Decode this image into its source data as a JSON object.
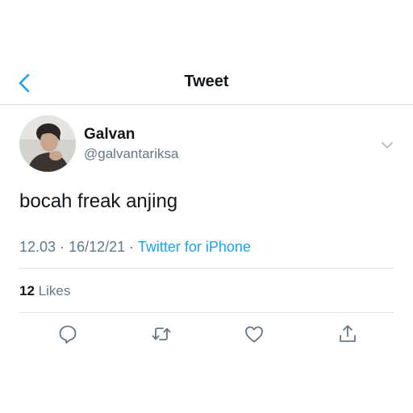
{
  "header": {
    "title": "Tweet",
    "back_icon": "chevron-left-icon",
    "accent": "#1da1f2"
  },
  "tweet": {
    "author_name": "Galvan",
    "author_handle": "@galvantariksa",
    "text": "bocah freak anjing",
    "time": "12.03",
    "separator1": "·",
    "date": "16/12/21",
    "separator2": "·",
    "source": "Twitter for iPhone",
    "likes_count": "12",
    "likes_label": "Likes"
  },
  "actions": [
    {
      "icon": "reply-icon"
    },
    {
      "icon": "retweet-icon"
    },
    {
      "icon": "like-icon"
    },
    {
      "icon": "share-icon"
    }
  ],
  "colors": {
    "text": "#14171a",
    "secondary": "#657786",
    "link": "#1da1f2",
    "divider": "#e1e8ed"
  }
}
